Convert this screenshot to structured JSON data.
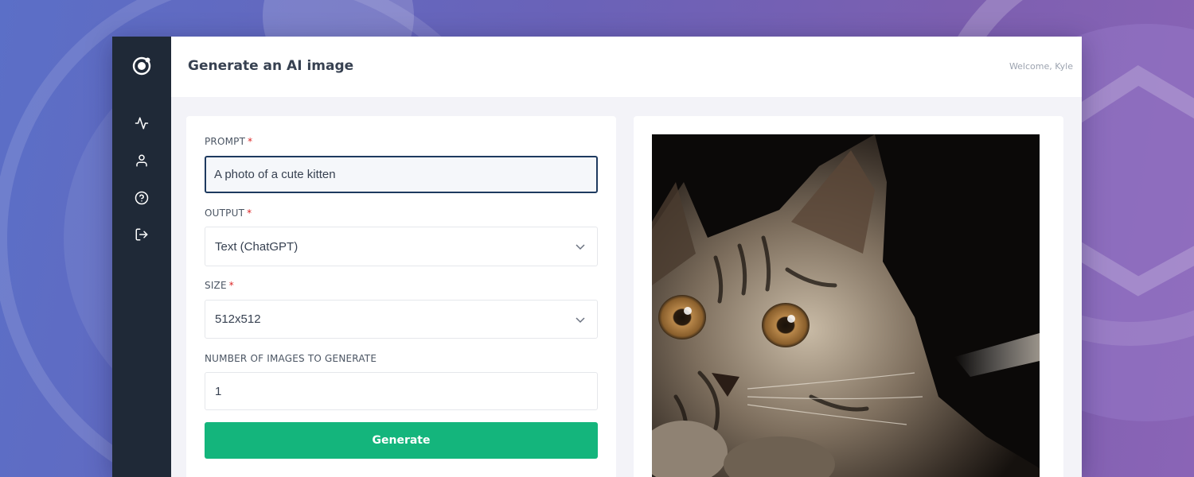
{
  "page": {
    "title": "Generate an AI image",
    "welcome": "Welcome, Kyle"
  },
  "sidebar": {
    "items": [
      {
        "name": "activity",
        "icon": "activity-icon"
      },
      {
        "name": "profile",
        "icon": "user-icon"
      },
      {
        "name": "help",
        "icon": "help-circle-icon"
      },
      {
        "name": "logout",
        "icon": "log-out-icon"
      }
    ]
  },
  "form": {
    "prompt": {
      "label": "PROMPT",
      "required": "*",
      "value": "A photo of a cute kitten"
    },
    "output": {
      "label": "OUTPUT",
      "required": "*",
      "value": "Text (ChatGPT)"
    },
    "size": {
      "label": "SIZE",
      "required": "*",
      "value": "512x512"
    },
    "count": {
      "label": "NUMBER OF IMAGES TO GENERATE",
      "value": "1"
    },
    "submit_label": "Generate"
  },
  "colors": {
    "sidebar": "#1f2937",
    "accent": "#14b57c",
    "required": "#dc2626",
    "focus_border": "#1e3a5f"
  }
}
